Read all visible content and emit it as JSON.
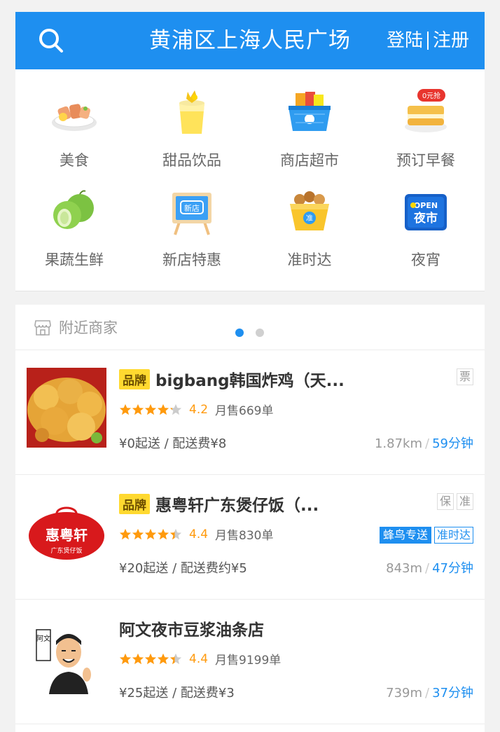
{
  "header": {
    "title": "黄浦区上海人民广场",
    "login": "登陆",
    "register": "注册"
  },
  "categories": [
    {
      "label": "美食",
      "icon": "food-plate-icon"
    },
    {
      "label": "甜品饮品",
      "icon": "drink-cup-icon"
    },
    {
      "label": "商店超市",
      "icon": "shopping-basket-icon"
    },
    {
      "label": "预订早餐",
      "icon": "breakfast-toast-icon",
      "tag": "0元抢"
    },
    {
      "label": "果蔬生鲜",
      "icon": "green-fruit-icon"
    },
    {
      "label": "新店特惠",
      "icon": "new-store-sign-icon",
      "tag": "新店"
    },
    {
      "label": "准时达",
      "icon": "ontime-box-icon",
      "tag": "准"
    },
    {
      "label": "夜宵",
      "icon": "night-market-icon",
      "tag_top": "OPEN",
      "tag": "夜市"
    }
  ],
  "pager": {
    "pages": 2,
    "active": 1
  },
  "nearby": {
    "title": "附近商家"
  },
  "shops": [
    {
      "brand": "品牌",
      "name": "bigbang韩国炸鸡（天...",
      "badges": [
        "票"
      ],
      "rating": 4.2,
      "stars": 4.2,
      "score": "4.2",
      "sold": "月售669单",
      "services": [],
      "fee": "¥0起送 / 配送费¥8",
      "distance": "1.87km",
      "time": "59分钟"
    },
    {
      "brand": "品牌",
      "name": "惠粤轩广东煲仔饭（...",
      "badges": [
        "保",
        "准"
      ],
      "rating": 4.4,
      "stars": 4.4,
      "score": "4.4",
      "sold": "月售830单",
      "services": [
        {
          "label": "蜂鸟专送",
          "style": "fill"
        },
        {
          "label": "准时达",
          "style": "line"
        }
      ],
      "fee": "¥20起送 / 配送费约¥5",
      "distance": "843m",
      "time": "47分钟",
      "logo_text": "惠粤轩",
      "logo_sub": "广东煲仔饭"
    },
    {
      "brand": "",
      "name": "阿文夜市豆浆油条店",
      "badges": [],
      "rating": 4.4,
      "stars": 4.4,
      "score": "4.4",
      "sold": "月售9199单",
      "services": [],
      "fee": "¥25起送 / 配送费¥3",
      "distance": "739m",
      "time": "37分钟",
      "logo_text": "阿文"
    }
  ],
  "colors": {
    "primary": "#1e8ff0",
    "star": "#ff9a0d",
    "brand_tag": "#ffd930"
  }
}
